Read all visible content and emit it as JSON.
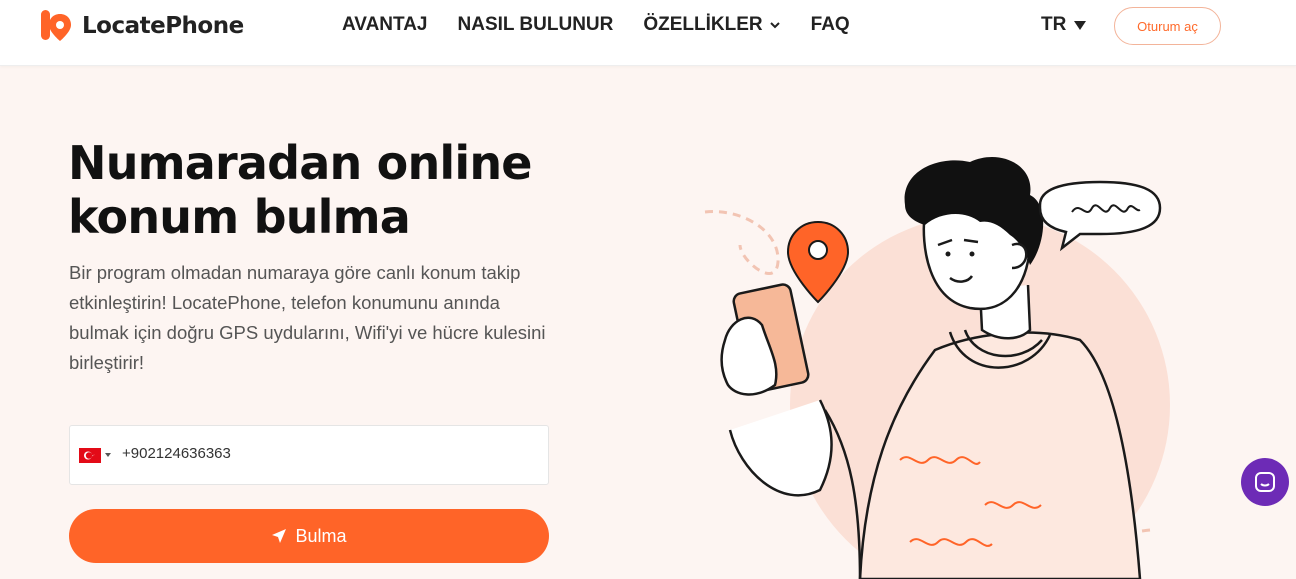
{
  "header": {
    "logo_text": "LocatePhone",
    "nav": [
      {
        "label": "AVANTAJ"
      },
      {
        "label": "NASIL BULUNUR"
      },
      {
        "label": "ÖZELLİKLER"
      },
      {
        "label": "FAQ"
      }
    ],
    "language": "TR",
    "login_label": "Oturum aç"
  },
  "hero": {
    "title_line1": "Numaradan online",
    "title_line2": "konum bulma",
    "description": "Bir program olmadan numaraya göre canlı konum takip etkinleştirin! LocatePhone, telefon konumunu anında bulmak için doğru GPS uydularını, Wifi'yi ve hücre kulesini birleştirir!",
    "phone_value": "+902124636363",
    "button_label": "Bulma"
  },
  "colors": {
    "brand": "#ff6428",
    "background": "#fdf5f2",
    "chat": "#6d2bb6",
    "flag": "#e30a17"
  },
  "icons": {
    "logo": "location-pin-logo-icon",
    "nav_dropdown": "chevron-down-icon",
    "language": "caret-down-icon",
    "flag": "turkey-flag-icon",
    "button": "navigation-arrow-icon",
    "chat": "chat-bubble-icon"
  }
}
